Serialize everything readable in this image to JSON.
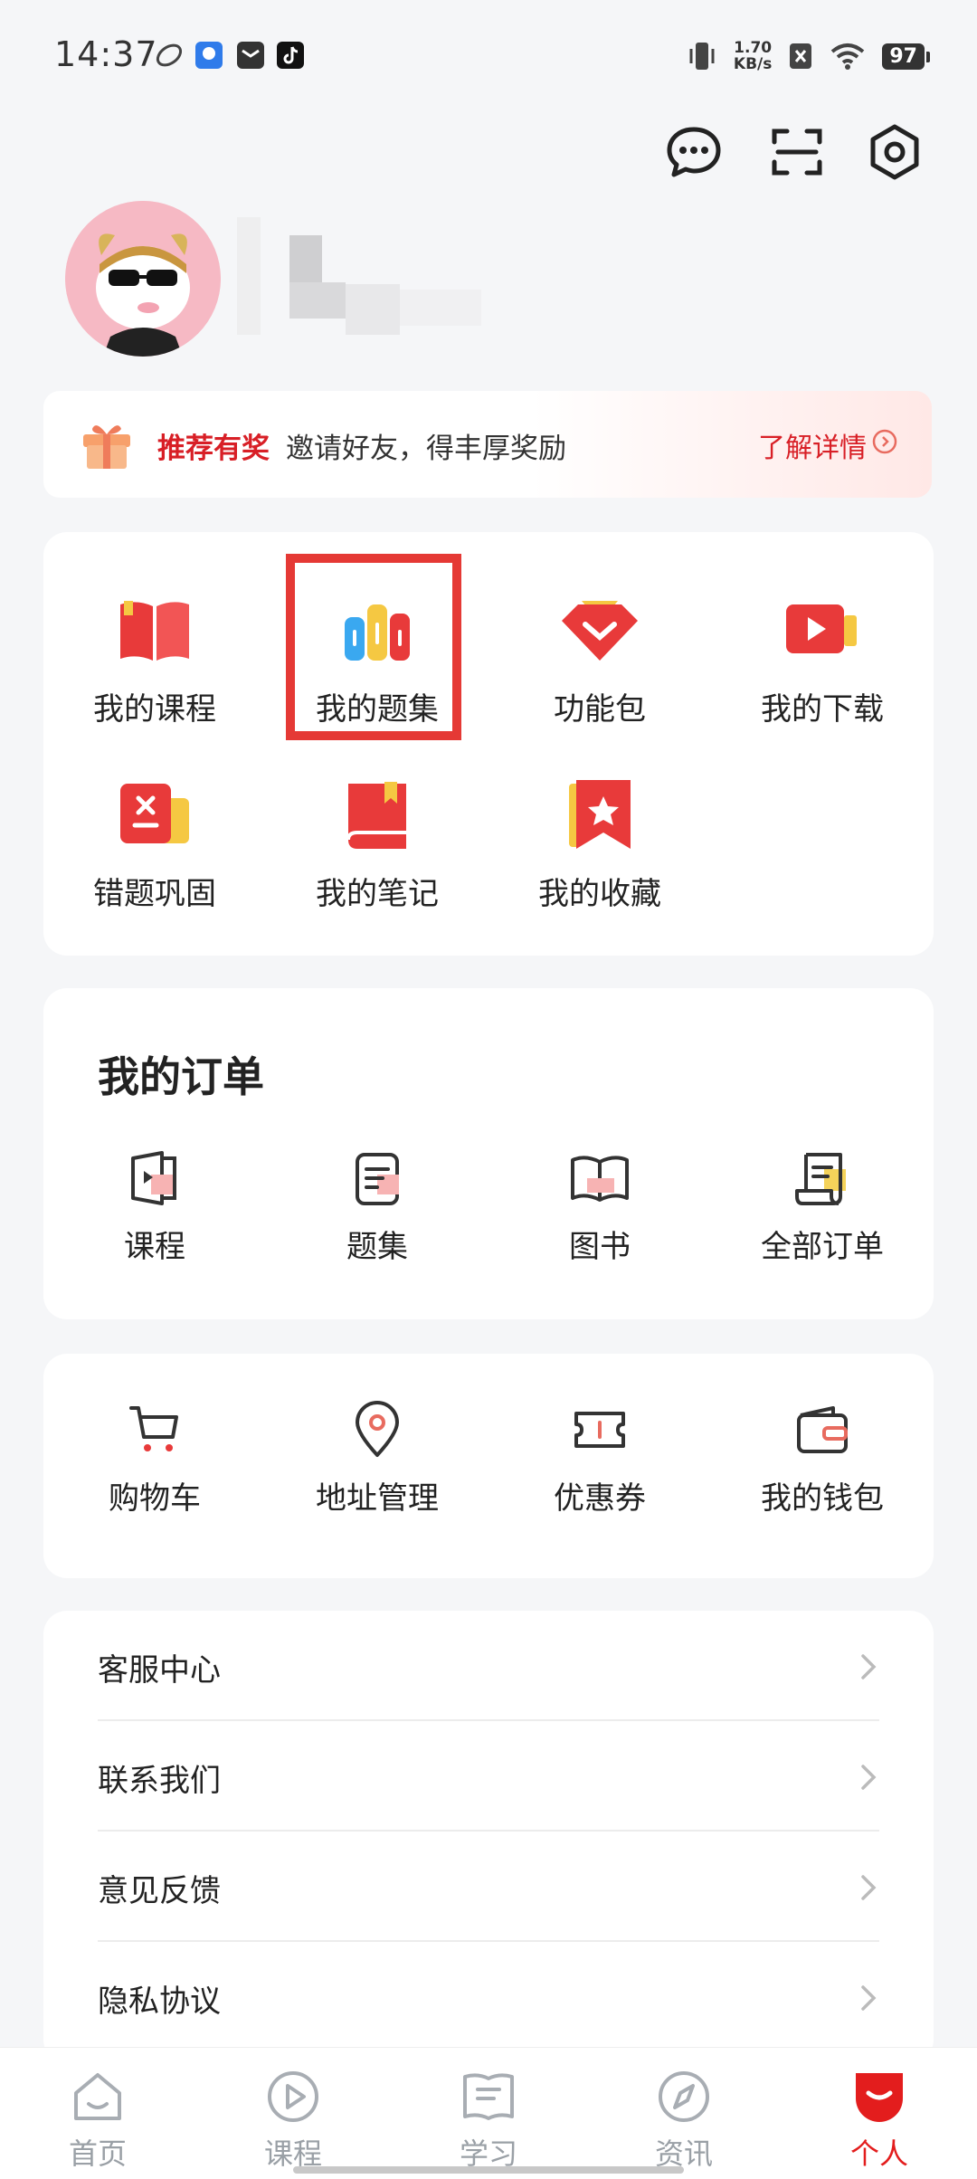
{
  "status": {
    "time": "14:37",
    "net_speed_value": "1.70",
    "net_speed_unit": "KB/s",
    "battery": "97"
  },
  "top_actions": [
    "message-icon",
    "scan-icon",
    "settings-icon"
  ],
  "banner": {
    "title": "推荐有奖",
    "desc": "邀请好友，得丰厚奖励",
    "more": "了解详情"
  },
  "features": {
    "items": [
      {
        "label": "我的课程",
        "icon": "course-book-icon"
      },
      {
        "label": "我的题集",
        "icon": "question-set-icon"
      },
      {
        "label": "功能包",
        "icon": "feature-pack-icon"
      },
      {
        "label": "我的下载",
        "icon": "download-video-icon"
      },
      {
        "label": "错题巩固",
        "icon": "wrong-question-icon"
      },
      {
        "label": "我的笔记",
        "icon": "notebook-icon"
      },
      {
        "label": "我的收藏",
        "icon": "favorite-icon"
      }
    ]
  },
  "orders": {
    "title": "我的订单",
    "items": [
      {
        "label": "课程",
        "icon": "course-order-icon"
      },
      {
        "label": "题集",
        "icon": "question-order-icon"
      },
      {
        "label": "图书",
        "icon": "book-order-icon"
      },
      {
        "label": "全部订单",
        "icon": "all-orders-icon"
      }
    ]
  },
  "services": {
    "items": [
      {
        "label": "购物车",
        "icon": "cart-icon"
      },
      {
        "label": "地址管理",
        "icon": "location-icon"
      },
      {
        "label": "优惠券",
        "icon": "coupon-icon"
      },
      {
        "label": "我的钱包",
        "icon": "wallet-icon"
      }
    ]
  },
  "list": {
    "items": [
      "客服中心",
      "联系我们",
      "意见反馈",
      "隐私协议"
    ]
  },
  "nav": {
    "items": [
      "首页",
      "课程",
      "学习",
      "资讯",
      "个人"
    ],
    "active": "个人"
  },
  "colors": {
    "accent": "#e31d1d",
    "background": "#f5f6f8",
    "highlight": "#e53935"
  }
}
